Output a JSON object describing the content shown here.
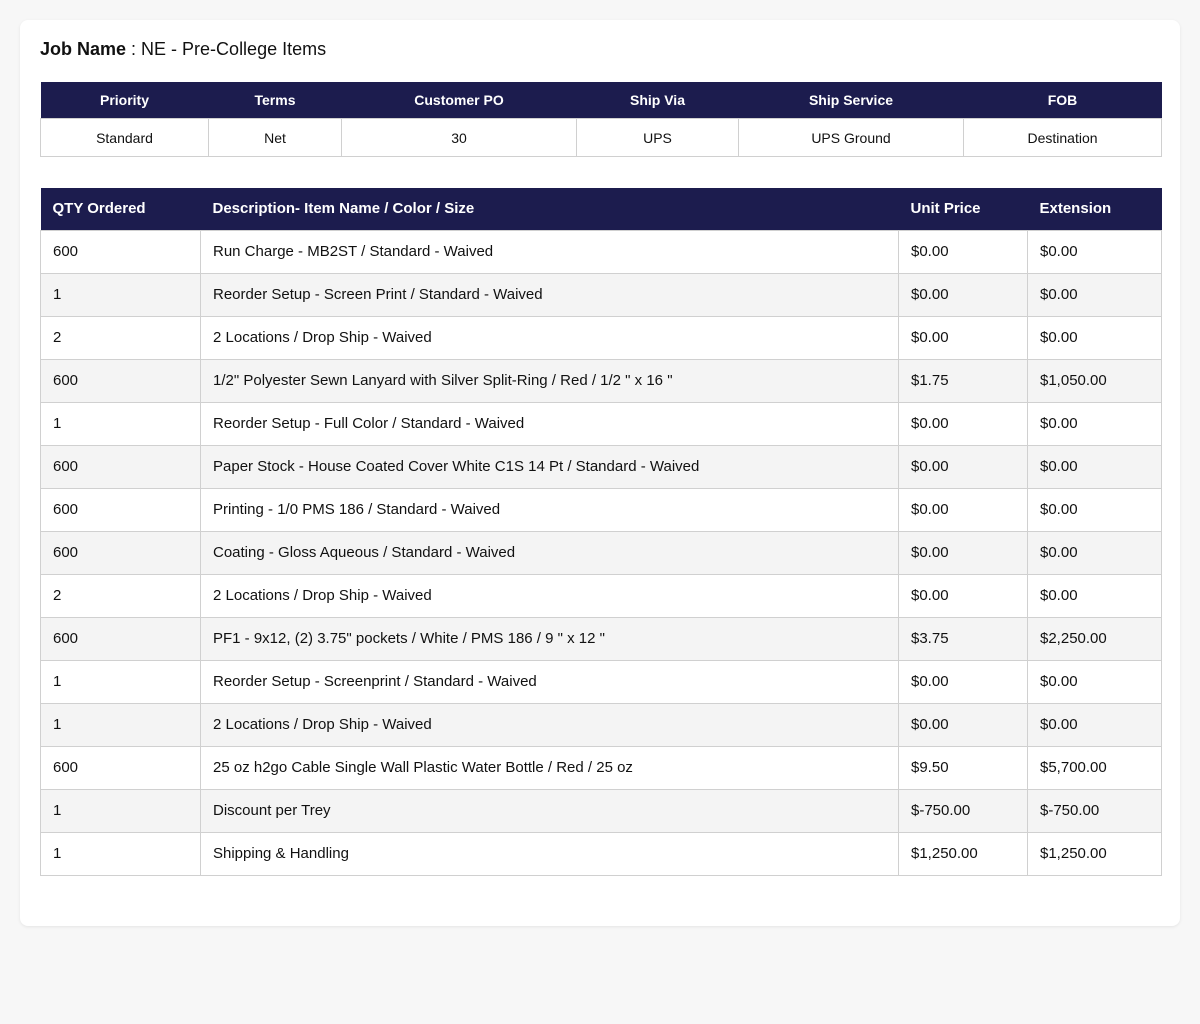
{
  "job": {
    "label": "Job Name",
    "separator": " : ",
    "value": "NE - Pre-College Items"
  },
  "meta": {
    "headers": [
      "Priority",
      "Terms",
      "Customer PO",
      "Ship Via",
      "Ship Service",
      "FOB"
    ],
    "values": [
      "Standard",
      "Net",
      "30",
      "UPS",
      "UPS Ground",
      "Destination"
    ]
  },
  "items": {
    "headers": [
      "QTY Ordered",
      "Description- Item Name / Color / Size",
      "Unit Price",
      "Extension"
    ],
    "rows": [
      [
        "600",
        "Run Charge - MB2ST / Standard - Waived",
        "$0.00",
        "$0.00"
      ],
      [
        "1",
        "Reorder Setup - Screen Print / Standard - Waived",
        "$0.00",
        "$0.00"
      ],
      [
        "2",
        "2 Locations / Drop Ship - Waived",
        "$0.00",
        "$0.00"
      ],
      [
        "600",
        "1/2\" Polyester Sewn Lanyard with Silver Split-Ring / Red / 1/2 \" x 16 \"",
        "$1.75",
        "$1,050.00"
      ],
      [
        "1",
        "Reorder Setup - Full Color / Standard - Waived",
        "$0.00",
        "$0.00"
      ],
      [
        "600",
        "Paper Stock - House Coated Cover White C1S 14 Pt / Standard - Waived",
        "$0.00",
        "$0.00"
      ],
      [
        "600",
        "Printing - 1/0 PMS 186 / Standard - Waived",
        "$0.00",
        "$0.00"
      ],
      [
        "600",
        "Coating - Gloss Aqueous / Standard - Waived",
        "$0.00",
        "$0.00"
      ],
      [
        "2",
        "2 Locations / Drop Ship - Waived",
        "$0.00",
        "$0.00"
      ],
      [
        "600",
        "PF1 - 9x12, (2) 3.75\" pockets / White / PMS 186 / 9 \" x 12 \"",
        "$3.75",
        "$2,250.00"
      ],
      [
        "1",
        "Reorder Setup - Screenprint / Standard - Waived",
        "$0.00",
        "$0.00"
      ],
      [
        "1",
        "2 Locations / Drop Ship - Waived",
        "$0.00",
        "$0.00"
      ],
      [
        "600",
        "25 oz h2go Cable Single Wall Plastic Water Bottle / Red / 25 oz",
        "$9.50",
        "$5,700.00"
      ],
      [
        "1",
        "Discount per Trey",
        "$-750.00",
        "$-750.00"
      ],
      [
        "1",
        "Shipping & Handling",
        "$1,250.00",
        "$1,250.00"
      ]
    ]
  },
  "colors": {
    "header_bg": "#1c1c4e",
    "header_text": "#ffffff",
    "row_alt": "#f4f4f4",
    "page_bg": "#f7f7f7"
  }
}
